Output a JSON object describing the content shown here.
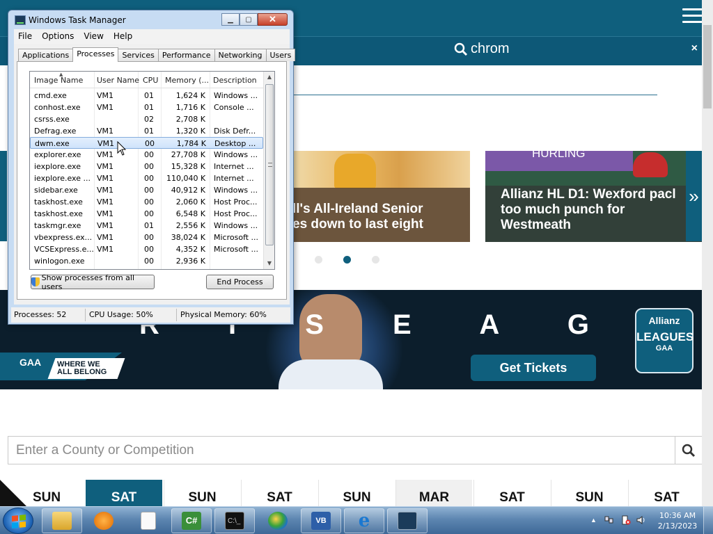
{
  "site": {
    "search_query": "chrom",
    "close_label": "×",
    "carousel": [
      {
        "title": "ll's All-Ireland Senior\nes down to last eight"
      },
      {
        "tag": "HURLING",
        "title": "Allianz HL D1: Wexford pacl\ntoo much punch for\nWestmeath"
      }
    ],
    "carousel_next": "»",
    "banner": {
      "slogan": "R I S E A G A I N",
      "gaa": "GAA",
      "belong": "WHERE WE\nALL BELONG",
      "tickets": "Get Tickets",
      "leagues_top": "Allianz",
      "leagues_main": "LEAGUES",
      "leagues_bottom": "GAA"
    },
    "county_placeholder": "Enter a County or Competition",
    "days": [
      "SUN",
      "SAT",
      "SUN",
      "SAT",
      "SUN",
      "MAR",
      "SAT",
      "SUN",
      "SAT"
    ]
  },
  "task_manager": {
    "title": "Windows Task Manager",
    "menu": [
      "File",
      "Options",
      "View",
      "Help"
    ],
    "tabs": [
      "Applications",
      "Processes",
      "Services",
      "Performance",
      "Networking",
      "Users"
    ],
    "active_tab": "Processes",
    "columns": [
      "Image Name",
      "User Name",
      "CPU",
      "Memory (...",
      "Description"
    ],
    "rows": [
      {
        "name": "cmd.exe",
        "user": "VM1",
        "cpu": "01",
        "mem": "1,624 K",
        "desc": "Windows ..."
      },
      {
        "name": "conhost.exe",
        "user": "VM1",
        "cpu": "01",
        "mem": "1,716 K",
        "desc": "Console ..."
      },
      {
        "name": "csrss.exe",
        "user": "",
        "cpu": "02",
        "mem": "2,708 K",
        "desc": ""
      },
      {
        "name": "Defrag.exe",
        "user": "VM1",
        "cpu": "01",
        "mem": "1,320 K",
        "desc": "Disk Defr..."
      },
      {
        "name": "dwm.exe",
        "user": "VM1",
        "cpu": "00",
        "mem": "1,784 K",
        "desc": "Desktop ..."
      },
      {
        "name": "explorer.exe",
        "user": "VM1",
        "cpu": "00",
        "mem": "27,708 K",
        "desc": "Windows ..."
      },
      {
        "name": "iexplore.exe",
        "user": "VM1",
        "cpu": "00",
        "mem": "15,328 K",
        "desc": "Internet ..."
      },
      {
        "name": "iexplore.exe ...",
        "user": "VM1",
        "cpu": "00",
        "mem": "110,040 K",
        "desc": "Internet ..."
      },
      {
        "name": "sidebar.exe",
        "user": "VM1",
        "cpu": "00",
        "mem": "40,912 K",
        "desc": "Windows ..."
      },
      {
        "name": "taskhost.exe",
        "user": "VM1",
        "cpu": "00",
        "mem": "2,060 K",
        "desc": "Host Proc..."
      },
      {
        "name": "taskhost.exe",
        "user": "VM1",
        "cpu": "00",
        "mem": "6,548 K",
        "desc": "Host Proc..."
      },
      {
        "name": "taskmgr.exe",
        "user": "VM1",
        "cpu": "01",
        "mem": "2,556 K",
        "desc": "Windows ..."
      },
      {
        "name": "vbexpress.ex...",
        "user": "VM1",
        "cpu": "00",
        "mem": "38,024 K",
        "desc": "Microsoft ..."
      },
      {
        "name": "VCSExpress.e...",
        "user": "VM1",
        "cpu": "00",
        "mem": "4,352 K",
        "desc": "Microsoft ..."
      },
      {
        "name": "winlogon.exe",
        "user": "",
        "cpu": "00",
        "mem": "2,936 K",
        "desc": ""
      }
    ],
    "selected_row": 4,
    "show_all_label": "Show processes from all users",
    "end_process_label": "End Process",
    "status": {
      "processes": "Processes: 52",
      "cpu": "CPU Usage: 50%",
      "memory": "Physical Memory: 60%"
    }
  },
  "taskbar": {
    "time": "10:36 AM",
    "date": "2/13/2023",
    "apps": [
      "explorer",
      "media-player",
      "notepad",
      "csharp-express",
      "command-prompt",
      "windows-update",
      "vb-express",
      "internet-explorer",
      "task-manager"
    ]
  },
  "colors": {
    "site_teal": "#0f5f7d",
    "selection": "#cfe3fb"
  }
}
